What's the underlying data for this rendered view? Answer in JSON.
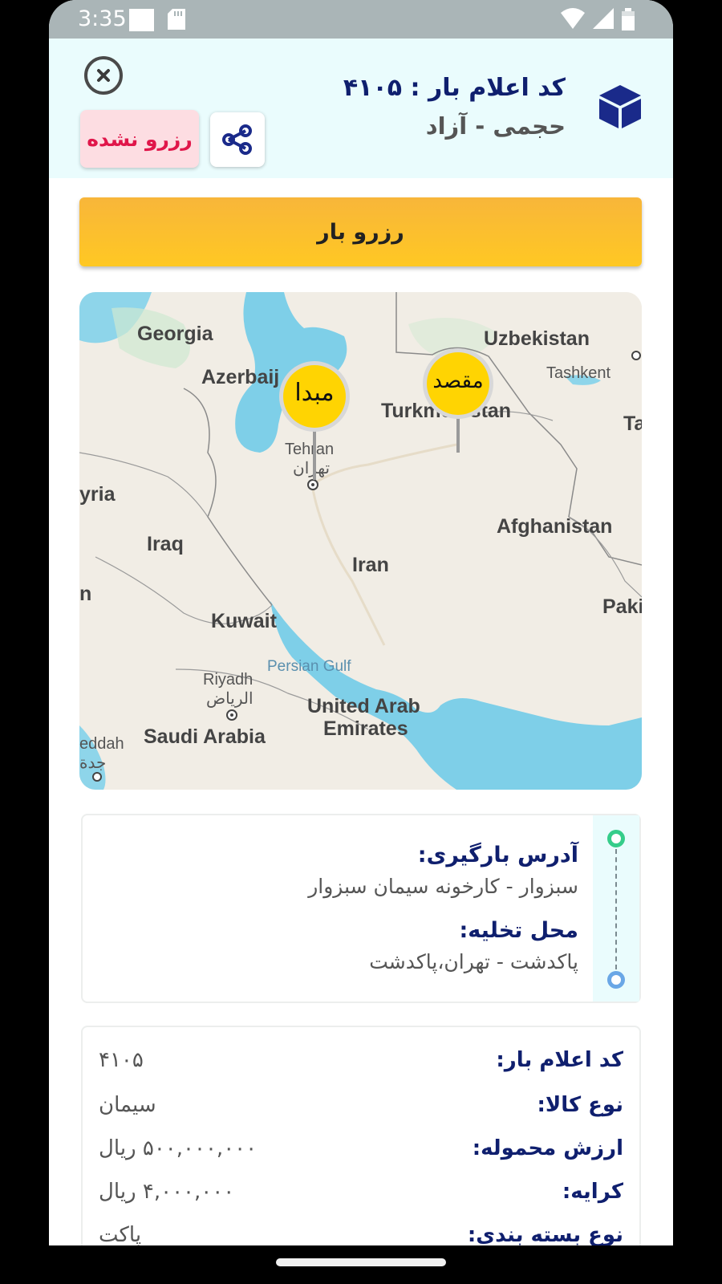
{
  "status_bar": {
    "time": "3:35"
  },
  "header": {
    "cargo_code": "کد اعلام بار : ۴۱۰۵",
    "cargo_type": "حجمی - آزاد",
    "status_label": "رزرو نشده"
  },
  "reserve_button": {
    "label": "رزرو بار"
  },
  "map": {
    "origin_pin": "مبدا",
    "destination_pin": "مقصد",
    "labels": {
      "georgia": "Georgia",
      "azerbaijan": "Azerbaij",
      "uzbekistan": "Uzbekistan",
      "tashkent": "Tashkent",
      "turkmenistan": "Turkmenistan",
      "ta": "Ta",
      "tehran": "Tehran",
      "tehran_fa": "تهران",
      "syria": "yria",
      "afghanistan": "Afghanistan",
      "iraq": "Iraq",
      "iran": "Iran",
      "n": "n",
      "pakistan": "Paki",
      "kuwait": "Kuwait",
      "persian_gulf": "Persian Gulf",
      "riyadh": "Riyadh",
      "riyadh_fa": "الرياض",
      "uae_1": "United Arab",
      "uae_2": "Emirates",
      "saudi": "Saudi Arabia",
      "jeddah": "eddah",
      "jeddah_fa": "جدة"
    }
  },
  "route": {
    "loading_label": "آدرس بارگیری:",
    "loading_value": "سبزوار - کارخونه سیمان سبزوار",
    "unloading_label": "محل تخلیه:",
    "unloading_value": "پاکدشت - تهران،پاکدشت"
  },
  "details": {
    "rows": [
      {
        "label": "کد اعلام بار:",
        "value": "۴۱۰۵"
      },
      {
        "label": "نوع کالا:",
        "value": "سیمان"
      },
      {
        "label": "ارزش محموله:",
        "value": "۵۰۰,۰۰۰,۰۰۰ ریال"
      },
      {
        "label": "کرایه:",
        "value": "۴,۰۰۰,۰۰۰ ریال"
      },
      {
        "label": "نوع بسته بندی:",
        "value": "پاکت"
      }
    ]
  },
  "colors": {
    "accent_navy": "#0f1f6e",
    "reserve_yellow": "#ffc823",
    "status_red": "#e0164a",
    "header_bg": "#eafcfd"
  }
}
